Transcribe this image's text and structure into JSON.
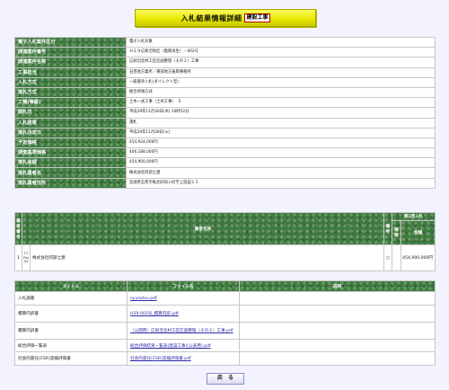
{
  "header": {
    "title": "入札結果情報詳細",
    "tag": "建設工事"
  },
  "info_rows": [
    {
      "label": "電子入札案件区分",
      "value": "電子入札対象"
    },
    {
      "label": "調達案件番号",
      "value": "Ｈ２９広剣沼地区（復興再生）－002号"
    },
    {
      "label": "調達案件名称",
      "value": "広剣沼北村工区区画整理（その２）工事"
    },
    {
      "label": "工事担当",
      "value": "石巻地方業所／東部地方振興事務所"
    },
    {
      "label": "入札方式",
      "value": "一般競争入札(ダイレクト型)"
    },
    {
      "label": "落札方式",
      "value": "総合評価方式"
    },
    {
      "label": "工種(等級)",
      "value": "土木一式工事（土木工事）　Ｓ"
    },
    {
      "label": "開札日",
      "value": "平成29年11月30日(木) 10時52分"
    },
    {
      "label": "入札結果",
      "value": "落札"
    },
    {
      "label": "落札決定日",
      "value": "平成29年11月28日(火)"
    },
    {
      "label": "予定価格",
      "value": "454,924,000円"
    },
    {
      "label": "調査基準価格",
      "value": "406,188,000円"
    },
    {
      "label": "落札金額",
      "value": "454,900,000円"
    },
    {
      "label": "落札業者名",
      "value": "株式会社阿部土建"
    },
    {
      "label": "落札業者住所",
      "value": "宮城県石巻市鮎北町知入町字上俣田１５"
    }
  ],
  "contractors": {
    "headers": {
      "no": "業者番号",
      "name": "業者名称",
      "status": "備考",
      "bid_group": "第1回入札",
      "bid_note": "摘要",
      "bid_amount": "金額"
    },
    "rows": [
      {
        "num": "1",
        "code": "17\nPal\n03",
        "name": "株式会社阿部土建",
        "status": "○",
        "note": "",
        "amount": "454,900,000円"
      }
    ]
  },
  "files": {
    "headers": {
      "title": "タイトル",
      "filename": "ファイル名",
      "note": "説明"
    },
    "rows": [
      {
        "title": "入札調書",
        "file": "nyusatsu.pdf",
        "note": ""
      },
      {
        "title": "積算内訳書",
        "file": "H29-002号_積算内訳.pdf",
        "note": ""
      },
      {
        "title": "積算内訳書",
        "file": "（公開用）広剣沼北村工区区画整理（その２）工事.pdf",
        "note": ""
      },
      {
        "title": "総合評価一覧表",
        "file": "総合評価結果一覧表(建設工事)(公表用).pdf",
        "note": ""
      },
      {
        "title": "社会的責任(CSR)実績評価書",
        "file": "社会的責任(CSR)実績評価書.pdf",
        "note": ""
      }
    ]
  },
  "back_button": "戻　る"
}
